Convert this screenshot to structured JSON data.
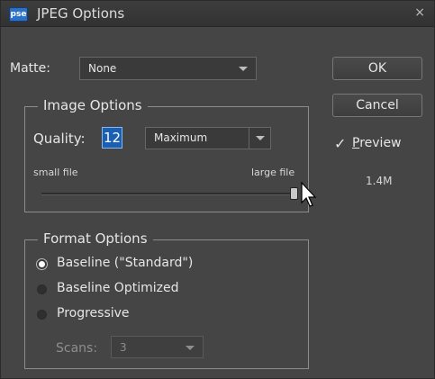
{
  "window": {
    "app_icon": "pse",
    "title": "JPEG Options",
    "close_icon": "×"
  },
  "matte": {
    "label": "Matte:",
    "value": "None"
  },
  "buttons": {
    "ok": "OK",
    "cancel": "Cancel"
  },
  "preview": {
    "checked": true,
    "check_glyph": "✓",
    "label": "Preview",
    "size": "1.4M"
  },
  "image_options": {
    "legend": "Image Options",
    "quality_label": "Quality:",
    "quality_value": "12",
    "preset_value": "Maximum",
    "small_file_label": "small file",
    "large_file_label": "large file",
    "slider_level": 1.0
  },
  "format_options": {
    "legend": "Format Options",
    "options": [
      {
        "label": "Baseline (\"Standard\")",
        "selected": true
      },
      {
        "label": "Baseline Optimized",
        "selected": false
      },
      {
        "label": "Progressive",
        "selected": false
      }
    ],
    "scans_label": "Scans:",
    "scans_value": "3"
  }
}
